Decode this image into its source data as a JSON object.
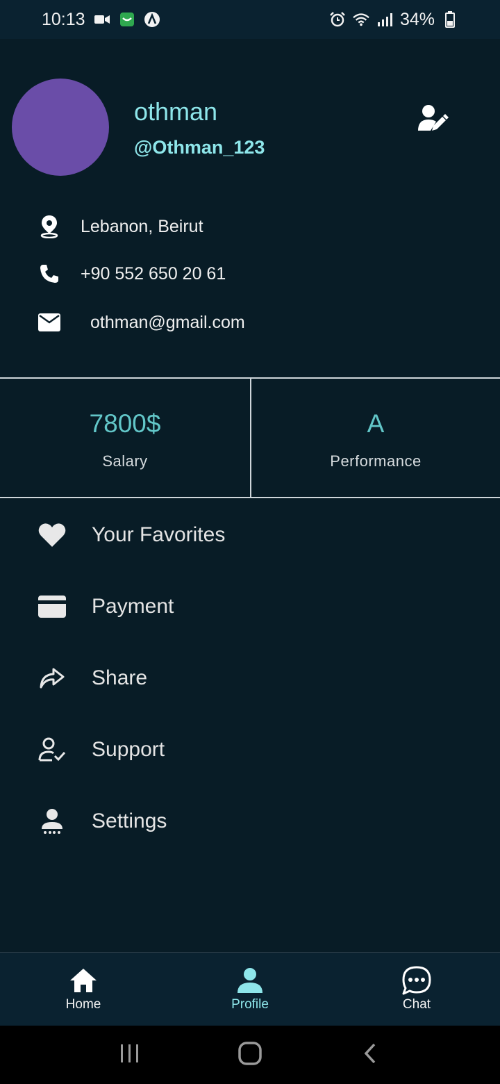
{
  "status_bar": {
    "time": "10:13",
    "battery": "34%",
    "left_icons": [
      "video-camera-icon",
      "app-notification-icon",
      "a-circle-icon"
    ],
    "right_icons": [
      "alarm-icon",
      "wifi-icon",
      "signal-icon",
      "battery-icon"
    ]
  },
  "profile": {
    "name": "othman",
    "handle": "@Othman_123",
    "avatar_color": "#6a4da8",
    "edit_icon": "edit-user-icon"
  },
  "contact": {
    "location": "Lebanon, Beirut",
    "phone": "+90 552 650 20 61",
    "email": "othman@gmail.com"
  },
  "stats": [
    {
      "value": "7800$",
      "label": "Salary"
    },
    {
      "value": "A",
      "label": "Performance"
    }
  ],
  "menu": [
    {
      "label": "Your Favorites",
      "icon": "heart-icon"
    },
    {
      "label": "Payment",
      "icon": "credit-card-icon"
    },
    {
      "label": "Share",
      "icon": "share-arrow-icon"
    },
    {
      "label": "Support",
      "icon": "user-check-icon"
    },
    {
      "label": "Settings",
      "icon": "user-settings-icon"
    }
  ],
  "bottom_nav": [
    {
      "label": "Home",
      "icon": "home-icon",
      "active": false
    },
    {
      "label": "Profile",
      "icon": "person-icon",
      "active": true
    },
    {
      "label": "Chat",
      "icon": "chat-bubble-icon",
      "active": false
    }
  ],
  "colors": {
    "background": "#081c26",
    "accent": "#8ee6ea",
    "stat_value": "#62c6c8",
    "avatar": "#6a4da8"
  }
}
